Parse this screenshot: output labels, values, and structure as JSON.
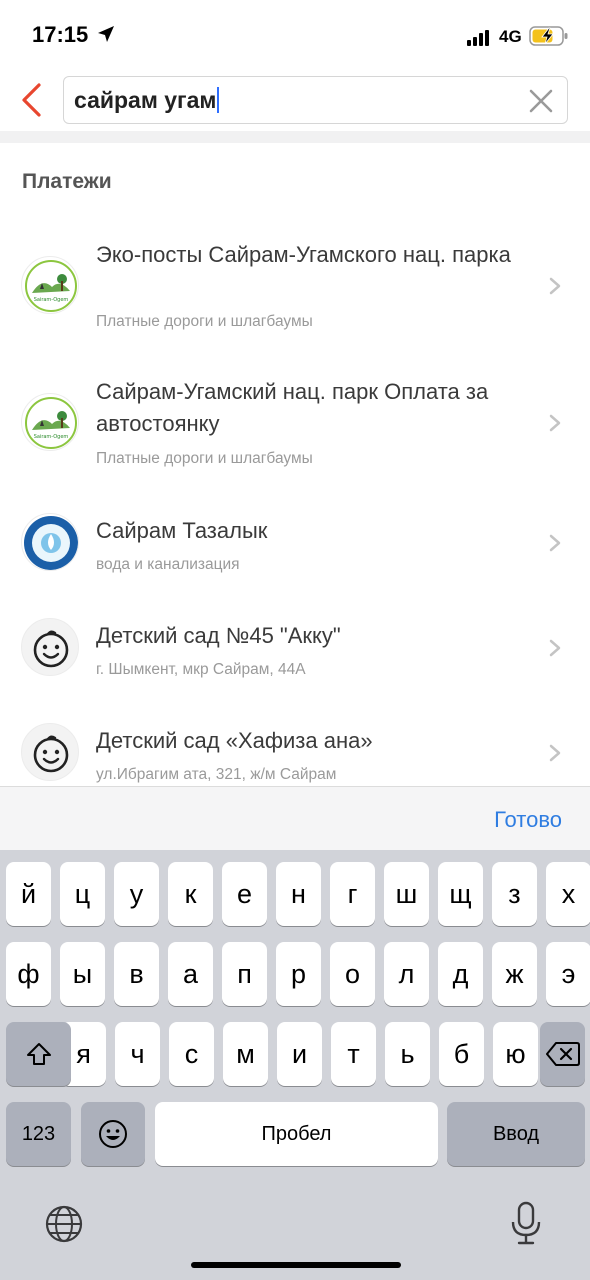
{
  "status_bar": {
    "time": "17:15",
    "network": "4G",
    "icons": [
      "location-arrow-icon",
      "signal-bars-icon",
      "battery-charging-icon"
    ]
  },
  "search": {
    "value": "сайрам угам",
    "back_icon": "chevron-left-icon",
    "clear_icon": "close-icon"
  },
  "section": {
    "title": "Платежи"
  },
  "results": [
    {
      "title": "Эко-посты Сайрам-Угамского нац. парка",
      "subtitle": "Платные дороги и шлагбаумы",
      "icon": "sairam-ugem-park-logo"
    },
    {
      "title": "Сайрам-Угамский нац. парк Оплата за автостоянку",
      "subtitle": "Платные дороги и шлагбаумы",
      "icon": "sairam-ugem-park-logo"
    },
    {
      "title": "Сайрам Тазалык",
      "subtitle": "вода и канализация",
      "icon": "sairam-tazalyk-logo"
    },
    {
      "title": "Детский сад №45 \"Акку\"",
      "subtitle": "г. Шымкент, мкр Сайрам, 44А",
      "icon": "baby-face-icon"
    },
    {
      "title": "Детский сад «Хафиза ана»",
      "subtitle": "ул.Ибрагим ата, 321, ж/м Сайрам",
      "icon": "baby-face-icon"
    }
  ],
  "keyboard": {
    "done_label": "Готово",
    "row1": [
      "й",
      "ц",
      "у",
      "к",
      "е",
      "н",
      "г",
      "ш",
      "щ",
      "з",
      "х"
    ],
    "row2": [
      "ф",
      "ы",
      "в",
      "а",
      "п",
      "р",
      "о",
      "л",
      "д",
      "ж",
      "э"
    ],
    "row3": [
      "я",
      "ч",
      "с",
      "м",
      "и",
      "т",
      "ь",
      "б",
      "ю"
    ],
    "numbers_label": "123",
    "space_label": "Пробел",
    "return_label": "Ввод",
    "icons": [
      "shift-icon",
      "backspace-icon",
      "emoji-icon",
      "globe-icon",
      "microphone-icon"
    ]
  },
  "colors": {
    "accent_red": "#e8462f",
    "link_blue": "#2f7de1",
    "keyboard_bg": "#d1d3d9"
  }
}
